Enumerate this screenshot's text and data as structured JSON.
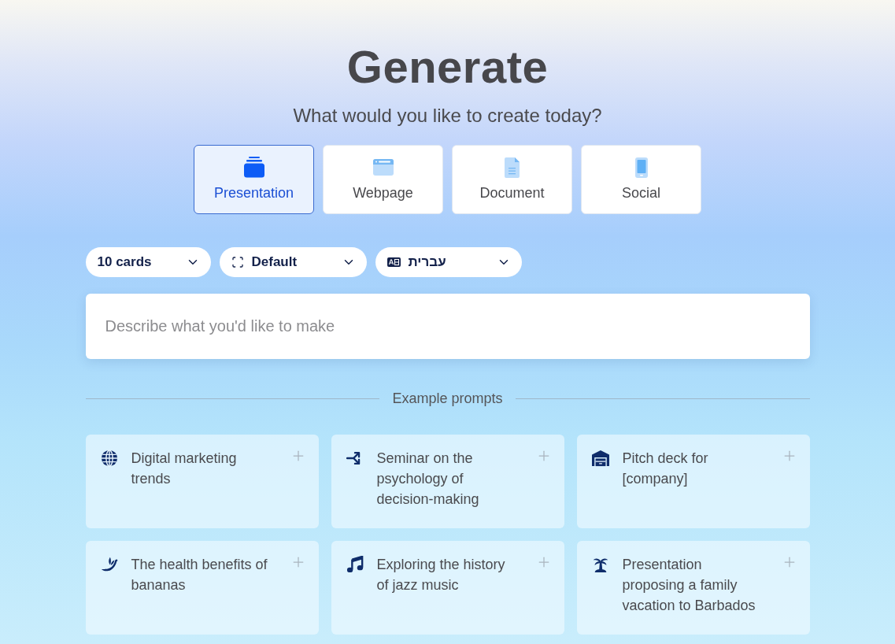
{
  "header": {
    "title": "Generate",
    "subtitle": "What would you like to create today?"
  },
  "modes": [
    {
      "kind": "presentation",
      "label": "Presentation",
      "selected": true
    },
    {
      "kind": "webpage",
      "label": "Webpage",
      "selected": false
    },
    {
      "kind": "document",
      "label": "Document",
      "selected": false
    },
    {
      "kind": "social",
      "label": "Social",
      "selected": false
    }
  ],
  "options": [
    {
      "kind": "count",
      "value": "10 cards"
    },
    {
      "kind": "theme",
      "value": "Default"
    },
    {
      "kind": "language",
      "value": "עברית"
    }
  ],
  "prompt_field": {
    "placeholder": "Describe what you'd like to make"
  },
  "examples": {
    "heading": "Example prompts",
    "items": [
      {
        "kind": "globe",
        "text": "Digital marketing trends"
      },
      {
        "kind": "split",
        "text": "Seminar on the psychology of decision-making"
      },
      {
        "kind": "garage",
        "text": "Pitch deck for [company]"
      },
      {
        "kind": "banana",
        "text": "The health benefits of bananas"
      },
      {
        "kind": "music",
        "text": "Exploring the history of jazz music"
      },
      {
        "kind": "island",
        "text": "Presentation proposing a family vacation to Barbados"
      }
    ]
  }
}
